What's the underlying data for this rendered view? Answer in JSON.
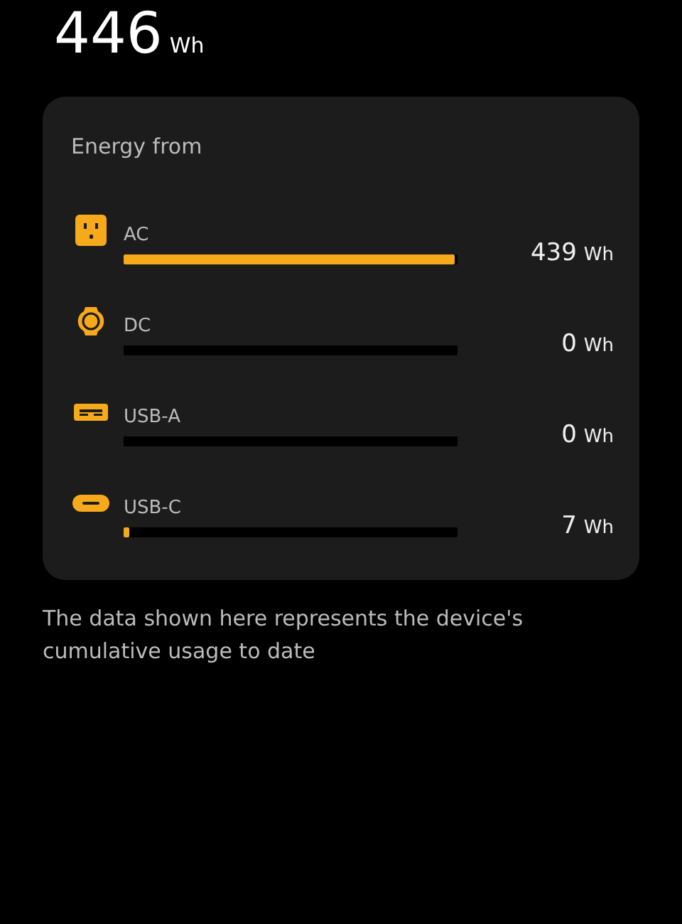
{
  "total": {
    "value": "446",
    "unit": "Wh"
  },
  "card": {
    "title": "Energy from",
    "sources": [
      {
        "kind": "ac",
        "label": "AC",
        "level": 0.99,
        "value": "439",
        "unit": "Wh"
      },
      {
        "kind": "dc",
        "label": "DC",
        "level": 0,
        "value": "0",
        "unit": "Wh"
      },
      {
        "kind": "usba",
        "label": "USB-A",
        "level": 0,
        "value": "0",
        "unit": "Wh"
      },
      {
        "kind": "usbc",
        "label": "USB-C",
        "level": 0.016,
        "value": "7",
        "unit": "Wh"
      }
    ]
  },
  "note": "The data shown here represents the device's cumulative usage to date"
}
